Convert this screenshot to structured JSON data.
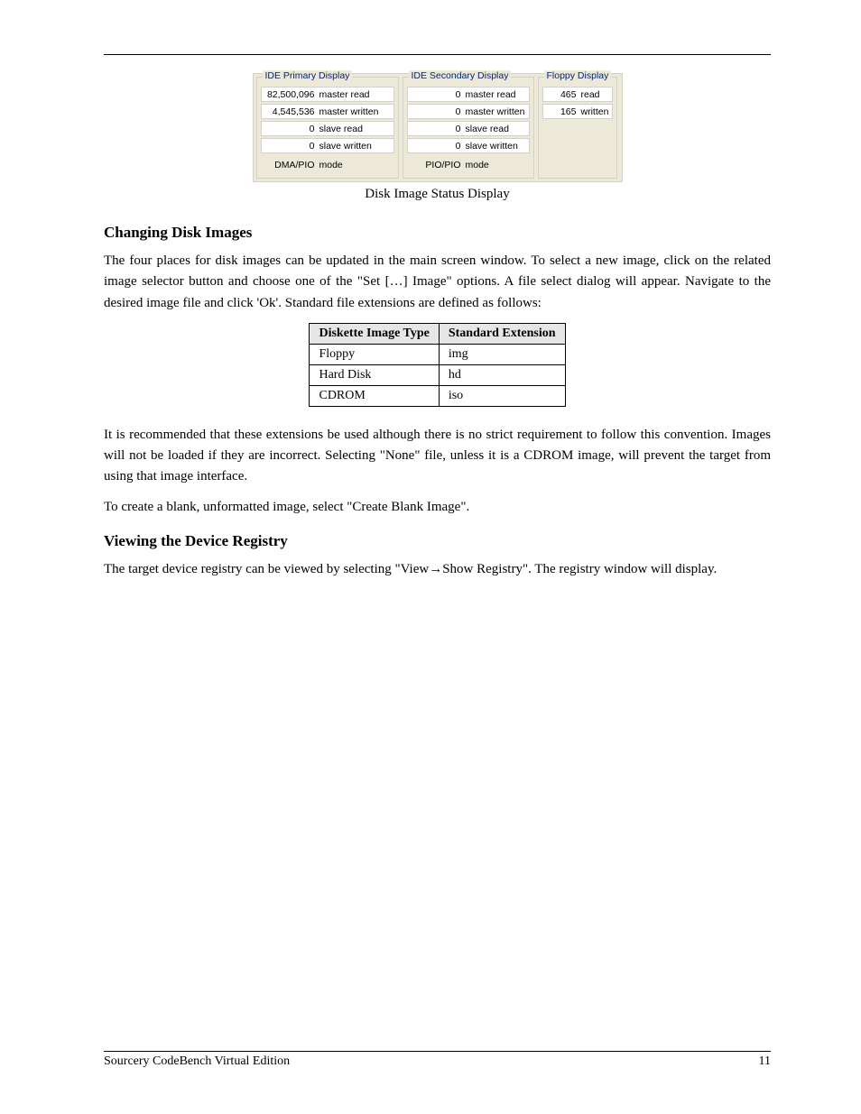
{
  "screenshot": {
    "primary": {
      "legend": "IDE Primary Display",
      "rows": [
        {
          "val": "82,500,096",
          "lbl": "master read"
        },
        {
          "val": "4,545,536",
          "lbl": "master written"
        },
        {
          "val": "0",
          "lbl": "slave read"
        },
        {
          "val": "0",
          "lbl": "slave written"
        }
      ],
      "mode": {
        "val": "DMA/PIO",
        "lbl": "mode"
      }
    },
    "secondary": {
      "legend": "IDE Secondary Display",
      "rows": [
        {
          "val": "0",
          "lbl": "master read"
        },
        {
          "val": "0",
          "lbl": "master written"
        },
        {
          "val": "0",
          "lbl": "slave read"
        },
        {
          "val": "0",
          "lbl": "slave written"
        }
      ],
      "mode": {
        "val": "PIO/PIO",
        "lbl": "mode"
      }
    },
    "floppy": {
      "legend": "Floppy Display",
      "rows": [
        {
          "val": "465",
          "lbl": "read"
        },
        {
          "val": "165",
          "lbl": "written"
        }
      ]
    }
  },
  "caption": "Disk Image Status Display",
  "section_images": {
    "title": "Changing Disk Images",
    "para": "The four places for disk images can be updated in the main screen window. To select a new image, click on the related image selector button and choose one of the \"Set […] Image\" options. A file select dialog will appear. Navigate to the desired image file and click 'Ok'. Standard file extensions are defined as follows:"
  },
  "file_table": {
    "headers": [
      "Diskette Image Type",
      "Standard Extension"
    ],
    "rows": [
      [
        "Floppy",
        "img"
      ],
      [
        "Hard Disk",
        "hd"
      ],
      [
        "CDROM",
        "iso"
      ]
    ]
  },
  "note_para": "It is recommended that these extensions be used although there is no strict requirement to follow this convention. Images will not be loaded if they are incorrect. Selecting \"None\" file, unless it is a CDROM image, will prevent the target from using that image interface.",
  "blank_para": "To create a blank, unformatted image, select \"Create Blank Image\".",
  "section_reg": {
    "title": "Viewing the Device Registry",
    "para": "The target device registry can be viewed by selecting \"View→Show Registry\". The registry window will display."
  },
  "footer": {
    "left": "Sourcery CodeBench Virtual Edition",
    "right": "11"
  }
}
